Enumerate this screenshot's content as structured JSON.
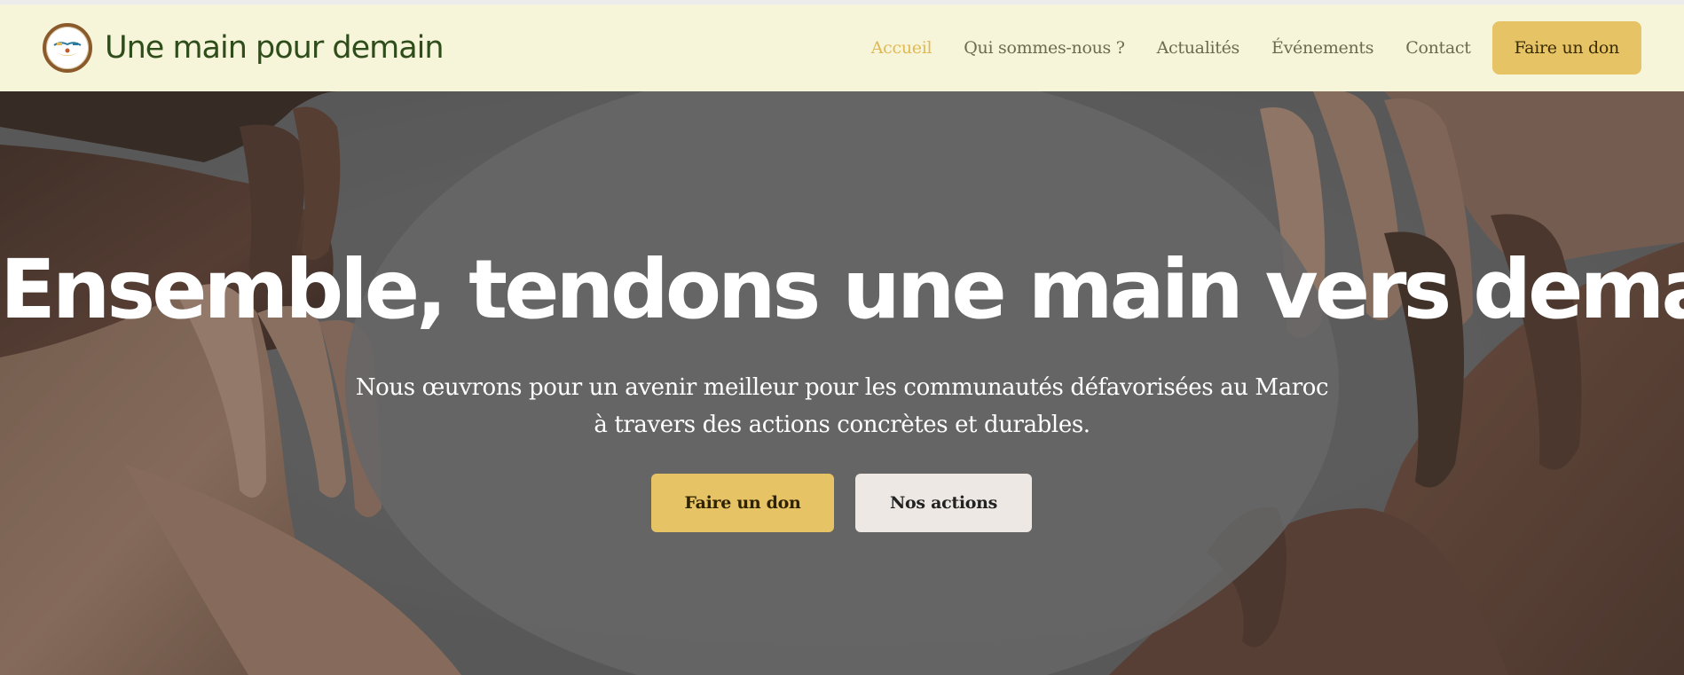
{
  "brand": {
    "name": "Une main pour demain",
    "logo_icon": "hands-logo-icon"
  },
  "nav": {
    "items": [
      {
        "label": "Accueil",
        "active": true
      },
      {
        "label": "Qui sommes-nous ?",
        "active": false
      },
      {
        "label": "Actualités",
        "active": false
      },
      {
        "label": "Événements",
        "active": false
      },
      {
        "label": "Contact",
        "active": false
      }
    ],
    "donate_label": "Faire un don"
  },
  "hero": {
    "title": "Ensemble, tendons une main vers demain.",
    "subtitle": "Nous œuvrons pour un avenir meilleur pour les communautés défavorisées au Maroc à travers des actions concrètes et durables.",
    "primary_button": "Faire un don",
    "secondary_button": "Nos actions",
    "background_image": "hands-circle-photo"
  },
  "colors": {
    "navbar_bg": "#f6f5da",
    "accent_gold": "#e6c466",
    "active_link": "#e0b955",
    "brand_green": "#2f4d1a",
    "hero_overlay": "#666666",
    "secondary_button_bg": "#ede8e3"
  }
}
